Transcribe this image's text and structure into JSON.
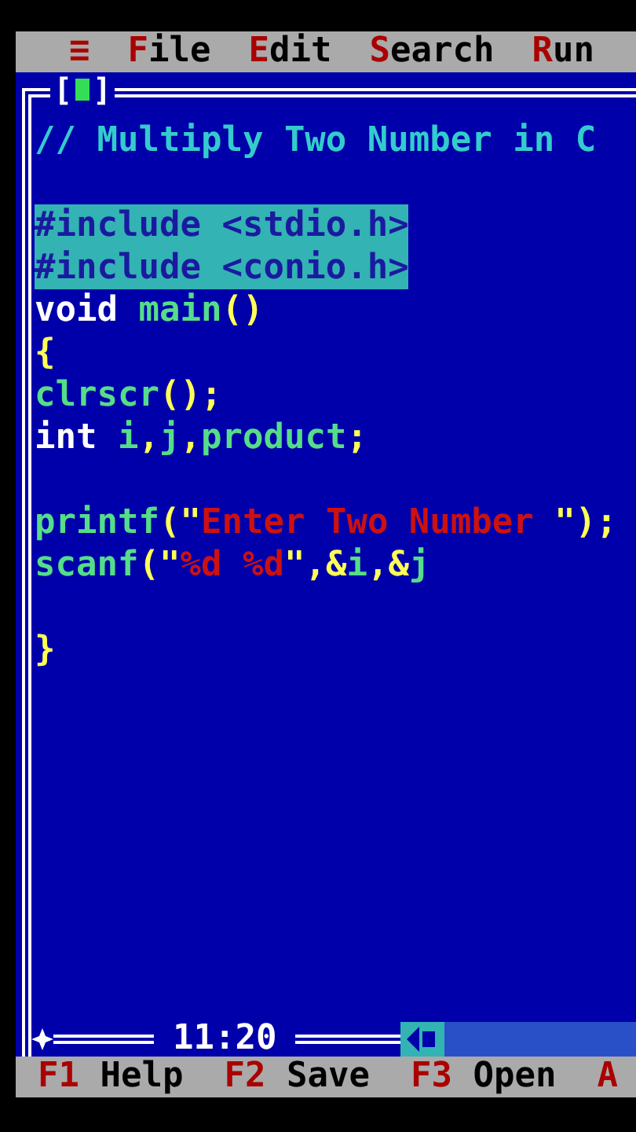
{
  "menu_bar": {
    "system_menu": "≡",
    "items": [
      {
        "hotkey": "F",
        "rest": "ile"
      },
      {
        "hotkey": "E",
        "rest": "dit"
      },
      {
        "hotkey": "S",
        "rest": "earch"
      },
      {
        "hotkey": "R",
        "rest": "un"
      }
    ]
  },
  "editor": {
    "close_box_left": "[",
    "close_box_right": "]",
    "lines": [
      {
        "kind": "code",
        "selected": false,
        "words": [
          [
            {
              "kind": "comment",
              "text": "// Multiply Two Number in C"
            }
          ]
        ]
      },
      {
        "kind": "blank"
      },
      {
        "kind": "code",
        "selected": true,
        "words": [
          [
            {
              "kind": "preprocessor",
              "text": "#include <stdio.h>"
            }
          ]
        ]
      },
      {
        "kind": "code",
        "selected": true,
        "words": [
          [
            {
              "kind": "preprocessor",
              "text": "#include <conio.h>"
            }
          ]
        ]
      },
      {
        "kind": "code",
        "selected": false,
        "words": [
          [
            {
              "kind": "keyword",
              "text": "void"
            }
          ],
          [
            {
              "kind": "identifier",
              "text": "main"
            },
            {
              "kind": "symbol",
              "text": "()"
            }
          ]
        ]
      },
      {
        "kind": "code",
        "selected": false,
        "words": [
          [
            {
              "kind": "symbol",
              "text": "{"
            }
          ]
        ]
      },
      {
        "kind": "code",
        "selected": false,
        "words": [
          [
            {
              "kind": "identifier",
              "text": "clrscr"
            },
            {
              "kind": "symbol",
              "text": "();"
            }
          ]
        ]
      },
      {
        "kind": "code",
        "selected": false,
        "words": [
          [
            {
              "kind": "keyword",
              "text": "int"
            }
          ],
          [
            {
              "kind": "identifier",
              "text": "i"
            },
            {
              "kind": "symbol",
              "text": ","
            },
            {
              "kind": "identifier",
              "text": "j"
            },
            {
              "kind": "symbol",
              "text": ","
            },
            {
              "kind": "identifier",
              "text": "product"
            },
            {
              "kind": "symbol",
              "text": ";"
            }
          ]
        ]
      },
      {
        "kind": "blank"
      },
      {
        "kind": "code",
        "selected": false,
        "words": [
          [
            {
              "kind": "identifier",
              "text": "printf"
            },
            {
              "kind": "symbol",
              "text": "(\""
            },
            {
              "kind": "string",
              "text": "Enter Two Number "
            },
            {
              "kind": "symbol",
              "text": "\");"
            }
          ]
        ]
      },
      {
        "kind": "code",
        "selected": false,
        "words": [
          [
            {
              "kind": "identifier",
              "text": "scanf"
            },
            {
              "kind": "symbol",
              "text": "(\""
            },
            {
              "kind": "string",
              "text": "%d %d"
            },
            {
              "kind": "symbol",
              "text": "\",&"
            },
            {
              "kind": "identifier",
              "text": "i"
            },
            {
              "kind": "symbol",
              "text": ",&"
            },
            {
              "kind": "identifier",
              "text": "j"
            }
          ]
        ]
      },
      {
        "kind": "blank"
      },
      {
        "kind": "code",
        "selected": false,
        "words": [
          [
            {
              "kind": "symbol",
              "text": "}"
            }
          ]
        ]
      }
    ],
    "cursor_position": "11:20"
  },
  "status_bar": [
    {
      "key": "F1",
      "label": "Help"
    },
    {
      "key": "F2",
      "label": "Save"
    },
    {
      "key": "F3",
      "label": "Open"
    },
    {
      "key": "A"
    }
  ]
}
